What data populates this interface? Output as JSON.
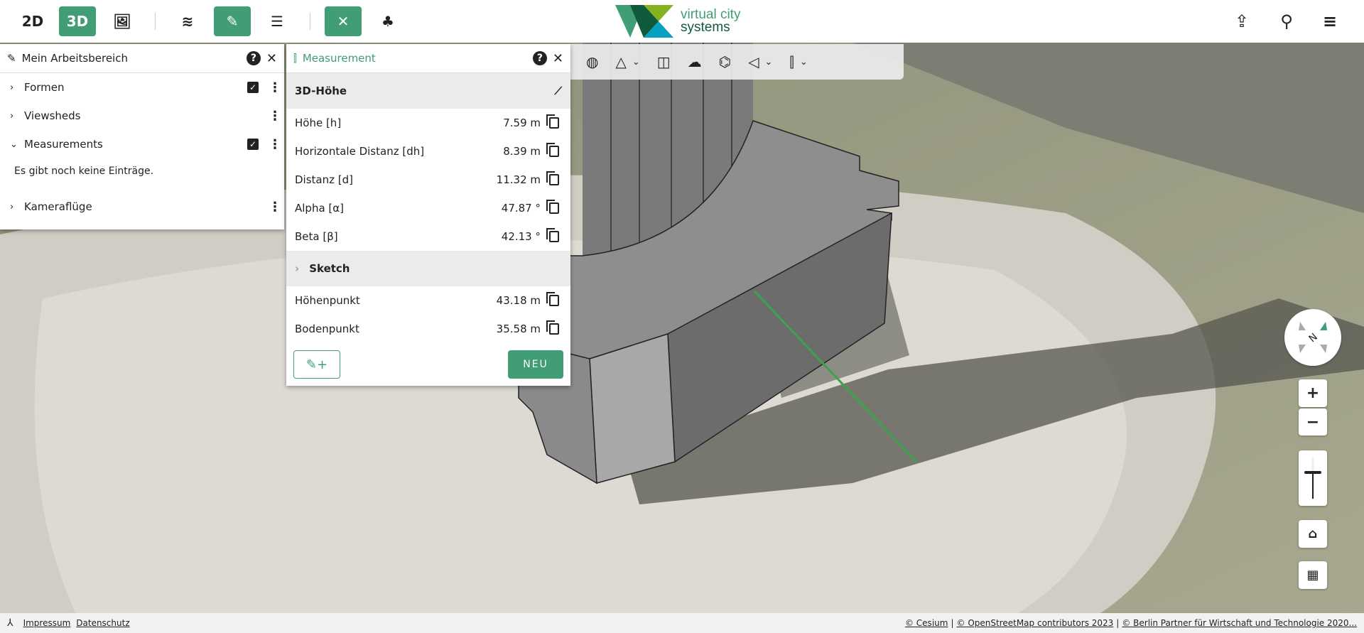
{
  "topbar": {
    "btn_2d": "2D",
    "btn_3d": "3D",
    "logo_line1": "virtual city",
    "logo_line2": "systems"
  },
  "workspace": {
    "title": "Mein Arbeitsbereich",
    "items": [
      {
        "label": "Formen",
        "checked": true
      },
      {
        "label": "Viewsheds"
      },
      {
        "label": "Measurements",
        "checked": true
      }
    ],
    "empty_text": "Es gibt noch keine Einträge.",
    "item_last": "Kameraflüge"
  },
  "measurement": {
    "title": "Measurement",
    "section": "3D-Höhe",
    "rows": [
      {
        "label": "Höhe [h]",
        "value": "7.59 m"
      },
      {
        "label": "Horizontale Distanz [dh]",
        "value": "8.39 m"
      },
      {
        "label": "Distanz [d]",
        "value": "11.32 m"
      },
      {
        "label": "Alpha [α]",
        "value": "47.87 °"
      },
      {
        "label": "Beta [β]",
        "value": "42.13 °"
      }
    ],
    "sketch": "Sketch",
    "points": [
      {
        "label": "Höhenpunkt",
        "value": "43.18 m"
      },
      {
        "label": "Bodenpunkt",
        "value": "35.58 m"
      }
    ],
    "new_label": "NEU"
  },
  "footer": {
    "impressum": "Impressum",
    "datenschutz": "Datenschutz",
    "attribution": [
      "© Cesium",
      "© OpenStreetMap contributors 2023",
      "© Berlin Partner für Wirtschaft und Technologie 2020..."
    ]
  },
  "colors": {
    "accent": "#409d76"
  }
}
